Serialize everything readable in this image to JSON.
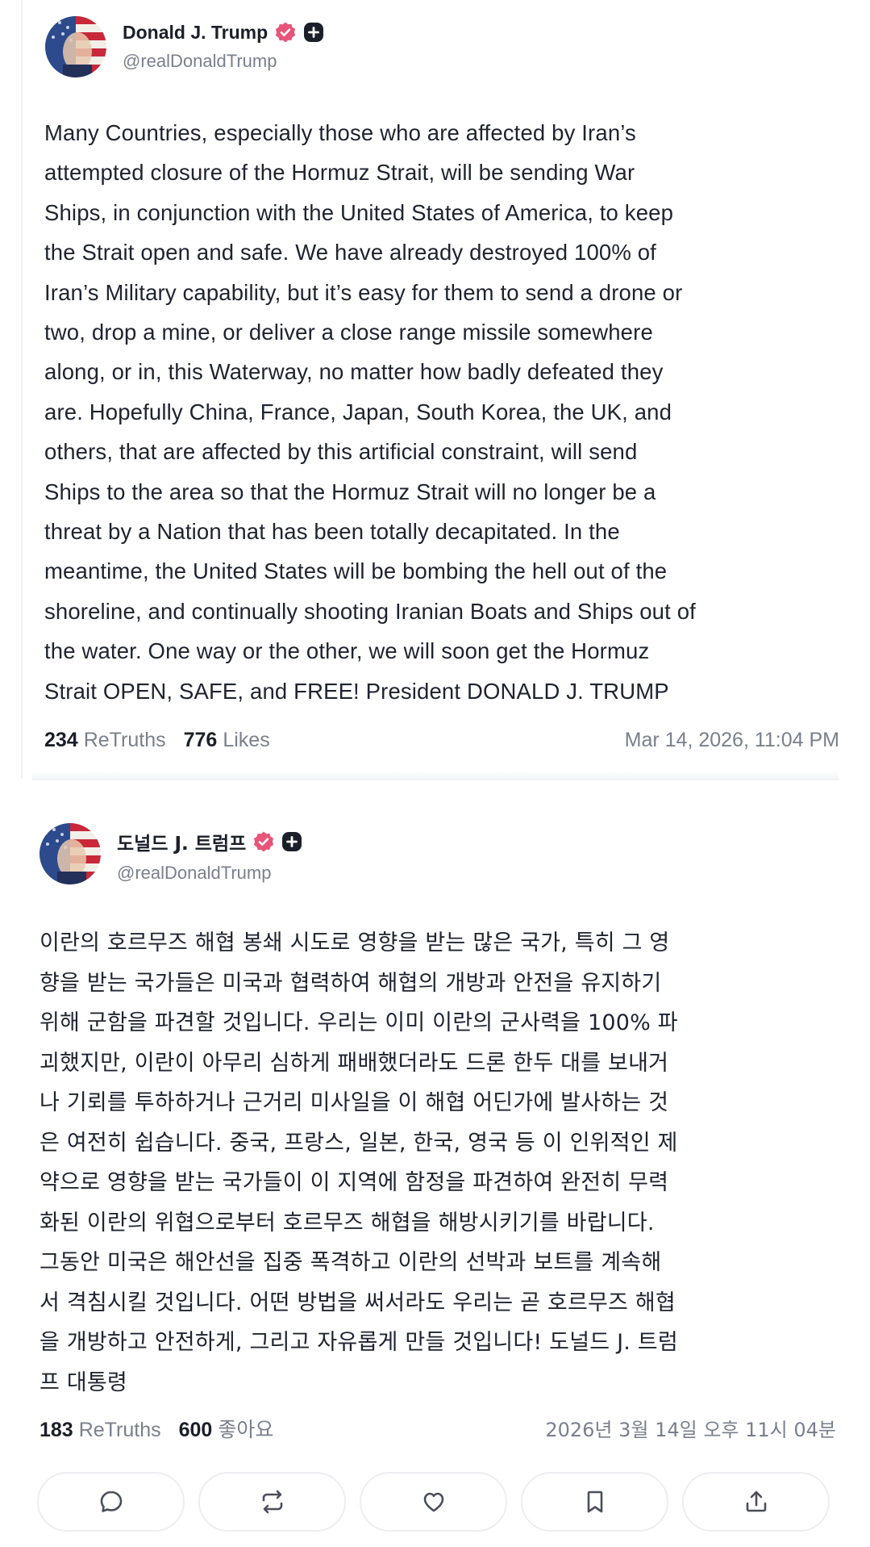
{
  "posts": [
    {
      "author": {
        "name": "Donald J. Trump",
        "handle": "@realDonaldTrump",
        "verified_icon": "verified-badge-icon",
        "plus_icon": "plus-badge-icon",
        "badge_color": "#e8557a"
      },
      "body": "Many Countries, especially those who are affected by Iran’s\nattempted closure of the Hormuz Strait, will be sending War\nShips, in conjunction with the United States of America, to keep\nthe Strait open and safe. We have already destroyed 100% of\nIran’s Military capability, but it’s easy for them to send a drone or\ntwo, drop a mine, or deliver a close range missile somewhere\nalong, or in, this Waterway, no matter how badly defeated they\nare. Hopefully China, France, Japan, South Korea, the UK, and\nothers, that are affected by this artificial constraint, will send\nShips to the area so that the Hormuz Strait will no longer be a\nthreat by a Nation that has been totally decapitated. In the\nmeantime, the United States will be bombing the hell out of the\nshoreline, and continually shooting Iranian Boats and Ships out of\nthe water. One way or the other, we will soon get the Hormuz\nStrait OPEN, SAFE, and FREE! President DONALD J. TRUMP",
      "retruths_count": "234",
      "retruths_label": "ReTruths",
      "likes_count": "776",
      "likes_label": "Likes",
      "timestamp": "Mar 14, 2026, 11:04 PM"
    },
    {
      "author": {
        "name": "도널드 J. 트럼프",
        "handle": "@realDonaldTrump",
        "verified_icon": "verified-badge-icon",
        "plus_icon": "plus-badge-icon",
        "badge_color": "#e8557a"
      },
      "body": "이란의 호르무즈 해협 봉쇄 시도로 영향을 받는 많은 국가, 특히 그 영\n향을 받는 국가들은 미국과 협력하여 해협의 개방과 안전을 유지하기\n위해 군함을 파견할 것입니다. 우리는 이미 이란의 군사력을 100% 파\n괴했지만, 이란이 아무리 심하게 패배했더라도 드론 한두 대를 보내거\n나 기뢰를 투하하거나 근거리 미사일을 이 해협 어딘가에 발사하는 것\n은 여전히 쉽습니다. 중국, 프랑스, 일본, 한국, 영국 등 이 인위적인 제\n약으로 영향을 받는 국가들이 이 지역에 함정을 파견하여 완전히 무력\n화된 이란의 위협으로부터 호르무즈 해협을 해방시키기를 바랍니다.\n그동안 미국은 해안선을 집중 폭격하고 이란의 선박과 보트를 계속해\n서 격침시킬 것입니다. 어떤 방법을 써서라도 우리는 곧 호르무즈 해협\n을 개방하고 안전하게, 그리고 자유롭게 만들 것입니다! 도널드 J. 트럼\n프 대통령",
      "retruths_count": "183",
      "retruths_label": "ReTruths",
      "likes_count": "600",
      "likes_label": "좋아요",
      "timestamp": "2026년 3월 14일 오후 11시 04분"
    }
  ],
  "actions": [
    {
      "name": "reply",
      "icon": "reply-bubble-icon"
    },
    {
      "name": "retruth",
      "icon": "retruth-arrows-icon"
    },
    {
      "name": "like",
      "icon": "heart-icon"
    },
    {
      "name": "bookmark",
      "icon": "bookmark-icon"
    },
    {
      "name": "share",
      "icon": "share-upload-icon"
    }
  ],
  "colors": {
    "text_primary": "#1f2330",
    "text_muted": "#7a7f8c",
    "badge_pink": "#e8557a",
    "button_border": "#eceef1"
  }
}
